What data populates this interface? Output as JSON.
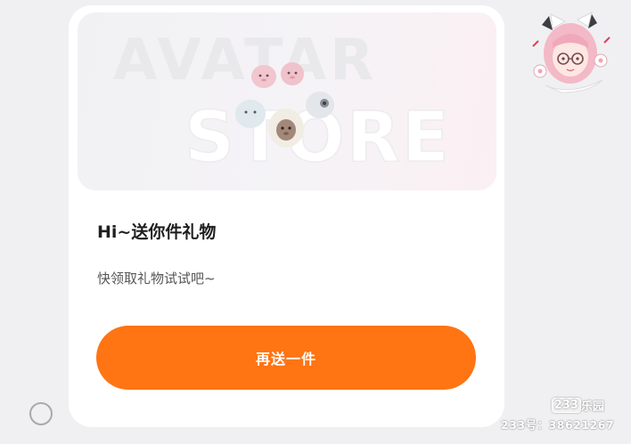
{
  "dialog": {
    "banner": {
      "title": "AVATAR",
      "subtitle": "STORE",
      "art_icon": "avatar-pets-icon"
    },
    "greeting": "Hi~送你件礼物",
    "message": "快领取礼物试试吧~",
    "send_button_label": "再送一件"
  },
  "floating_avatar": {
    "icon": "anime-girl-avatar-icon"
  },
  "watermark": {
    "logo_number": "233",
    "logo_text": "乐园",
    "id_text": "233号：38621267"
  },
  "colors": {
    "accent": "#ff7413",
    "background": "#f0f0f2",
    "card": "#ffffff"
  }
}
